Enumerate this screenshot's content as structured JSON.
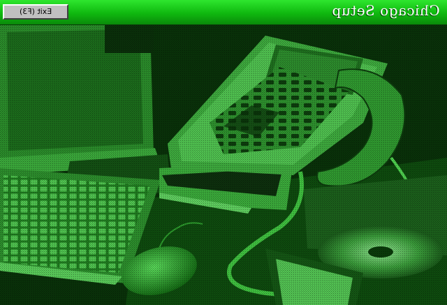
{
  "window": {
    "title": "Chicago Setup"
  },
  "toolbar": {
    "exit_label": "Exit (F3)"
  },
  "background": {
    "description_icon": "office-equipment-photo",
    "tint": "#1a8f1a"
  },
  "colors": {
    "titlebar_light": "#2ee62e",
    "titlebar_dark": "#0a8a0a",
    "button_face": "#c0c0c0"
  }
}
